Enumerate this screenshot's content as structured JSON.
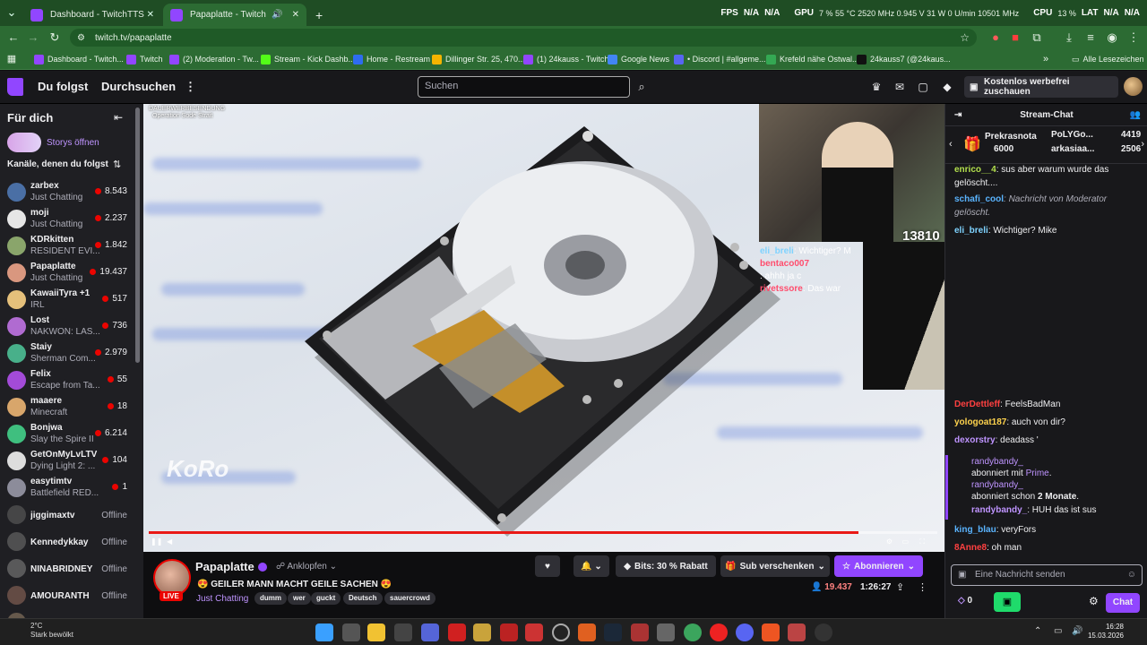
{
  "browser": {
    "tabs": [
      {
        "label": "Dashboard - TwitchTTS"
      },
      {
        "label": "Papaplatte - Twitch"
      }
    ],
    "new_tab": "+",
    "url": "twitch.tv/papaplatte",
    "hud": {
      "fps_label": "FPS",
      "fps_a": "N/A",
      "fps_b": "N/A",
      "gpu_label": "GPU",
      "gpu_text": "7 % 55 °C 2520 MHz 0.945 V 31 W 0 U/min 10501 MHz",
      "cpu_label": "CPU",
      "cpu_text": "13 %",
      "lat_label": "LAT",
      "lat_a": "N/A",
      "lat_b": "N/A"
    },
    "bookmarks": [
      {
        "label": "Dashboard - Twitch...",
        "color": "#9146ff"
      },
      {
        "label": "Twitch",
        "color": "#9146ff"
      },
      {
        "label": "(2) Moderation - Tw...",
        "color": "#9146ff"
      },
      {
        "label": "Stream - Kick Dashb...",
        "color": "#53fc18"
      },
      {
        "label": "Home - Restream",
        "color": "#2e6cf0"
      },
      {
        "label": "Dillinger Str. 25, 470...",
        "color": "#f4b400"
      },
      {
        "label": "(1) 24kauss - Twitch",
        "color": "#9146ff"
      },
      {
        "label": "Google News",
        "color": "#4285f4"
      },
      {
        "label": "• Discord | #allgeme...",
        "color": "#5865f2"
      },
      {
        "label": "Krefeld nähe Ostwal...",
        "color": "#34a853"
      },
      {
        "label": "24kauss7 (@24kaus...",
        "color": "#111111"
      }
    ],
    "all_bookmarks": "Alle Lesezeichen"
  },
  "nav": {
    "following": "Du folgst",
    "browse": "Durchsuchen",
    "search_placeholder": "Suchen",
    "promo": "Kostenlos werbefrei zuschauen"
  },
  "sidebar": {
    "title": "Für dich",
    "stories": "Storys öffnen",
    "channels_title": "Kanäle, denen du folgst",
    "channels": [
      {
        "name": "zarbex",
        "game": "Just Chatting",
        "viewers": "8.543",
        "color": "#4a6fa5"
      },
      {
        "name": "moji",
        "game": "Just Chatting",
        "viewers": "2.237",
        "color": "#e6e6e6"
      },
      {
        "name": "KDRkitten",
        "game": "RESIDENT EVI...",
        "viewers": "1.842",
        "color": "#8aa56b"
      },
      {
        "name": "Papaplatte",
        "game": "Just Chatting",
        "viewers": "19.437",
        "color": "#d9977f"
      },
      {
        "name": "KawaiiTyra +1",
        "game": "IRL",
        "viewers": "517",
        "color": "#e5c07b"
      },
      {
        "name": "Lost",
        "game": "NAKWON: LAS...",
        "viewers": "736",
        "color": "#b06bd1"
      },
      {
        "name": "Staiy",
        "game": "Sherman Com...",
        "viewers": "2.979",
        "color": "#48b08a"
      },
      {
        "name": "Felix",
        "game": "Escape from Ta...",
        "viewers": "55",
        "color": "#a34bd8"
      },
      {
        "name": "maaere",
        "game": "Minecraft",
        "viewers": "18",
        "color": "#d8a66b"
      },
      {
        "name": "Bonjwa",
        "game": "Slay the Spire II",
        "viewers": "6.214",
        "color": "#3fbf7f"
      },
      {
        "name": "GetOnMyLvLTV",
        "game": "Dying Light 2: ...",
        "viewers": "104",
        "color": "#dddddd"
      },
      {
        "name": "easytimtv",
        "game": "Battlefield RED...",
        "viewers": "1",
        "color": "#8c8c9a"
      },
      {
        "name": "jiggimaxtv",
        "game": "",
        "viewers": "Offline",
        "color": "#666666"
      },
      {
        "name": "Kennedykkay",
        "game": "",
        "viewers": "Offline",
        "color": "#777777"
      },
      {
        "name": "NINABRIDNEY",
        "game": "",
        "viewers": "Offline",
        "color": "#888888"
      },
      {
        "name": "AMOURANTH",
        "game": "",
        "viewers": "Offline",
        "color": "#9a7060"
      },
      {
        "name": "almostfeline",
        "game": "",
        "viewers": "Offline",
        "color": "#a08870"
      }
    ]
  },
  "player": {
    "overlay_top": "DAUERWERBESENDUNG",
    "overlay_sub": "Operation Sode Strait",
    "watermark": "KoRo",
    "cam_viewers": "13810",
    "overlay_chat": [
      {
        "user": "eli_breli",
        "text": ": Wichtiger? M",
        "color": "#7fd3ff"
      },
      {
        "user": "bentaco007",
        "text": "",
        "color": "#ff4d6d"
      },
      {
        "user": "",
        "text": ": ahhh ja c",
        "color": "#c58bff"
      },
      {
        "user": "",
        "text": "",
        "color": "#33d17a"
      },
      {
        "user": "rivetssore",
        "text": ": Das war",
        "color": "#ff4d6d"
      }
    ]
  },
  "stream": {
    "name": "Papaplatte",
    "pin_label": "Anklopfen",
    "live": "LIVE",
    "title": "GEILER MANN MACHT GEILE SACHEN",
    "game": "Just Chatting",
    "tags": [
      "dumm",
      "wer",
      "guckt",
      "Deutsch",
      "sauercrowd"
    ],
    "bits": "Bits: 30 % Rabatt",
    "gift": "Sub verschenken",
    "subscribe": "Abonnieren",
    "viewers": "19.437",
    "uptime": "1:26:27"
  },
  "chat": {
    "title": "Stream-Chat",
    "hype": {
      "name1": "Prekrasnota",
      "count1": "6000",
      "name2": "PoLYGo...",
      "count2": "4419",
      "name3": "arkasiaa...",
      "count3": "2506"
    },
    "messages_top": [
      {
        "user": "enrico__4",
        "text": ": sus aber warum wurde das gelöscht....",
        "color": "#b3e04d"
      },
      {
        "user": "schafi_cool",
        "text": ": Nachricht von Moderator gelöscht.",
        "color": "#5ab4ff",
        "mod": true
      },
      {
        "user": "eli_breli",
        "text": ": Wichtiger? Mike",
        "color": "#7fd3ff"
      }
    ],
    "messages_bottom": [
      {
        "user": "DerDettleff",
        "text": ": FeelsBadMan",
        "color": "#ff4040"
      },
      {
        "user": "yologoat187",
        "text": ": auch von dir?",
        "color": "#ffd34d"
      },
      {
        "user": "dexorstry",
        "text": ": deadass '",
        "color": "#bf94ff"
      }
    ],
    "sub_notice": {
      "user": "randybandy_",
      "line1": "abonniert mit",
      "prime": "Prime",
      "user2": "randybandy_",
      "line2": "abonniert schon",
      "months": "2 Monate",
      "msg_user": "randybandy_",
      "msg_text": ": HUH das ist sus"
    },
    "messages_end": [
      {
        "user": "king_blau",
        "text": ": veryFors",
        "color": "#5ab4ff"
      },
      {
        "user": "8Anne8",
        "text": ": oh man",
        "color": "#ff4040"
      }
    ],
    "input_placeholder": "Eine Nachricht senden",
    "points": "0",
    "send": "Chat"
  },
  "taskbar": {
    "weather_temp": "2°C",
    "weather_text": "Stark bewölkt",
    "time": "16:28",
    "date": "15.03.2026"
  }
}
